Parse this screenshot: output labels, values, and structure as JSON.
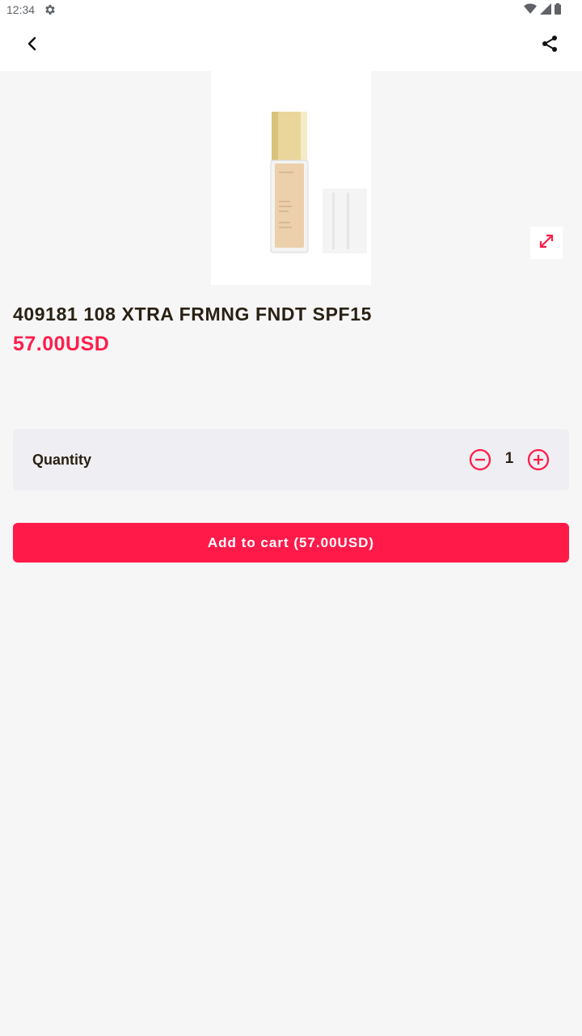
{
  "status_bar": {
    "time": "12:34",
    "icons": [
      "gear-icon",
      "wifi-icon",
      "signal-icon",
      "battery-icon"
    ]
  },
  "app_bar": {
    "back_icon": "chevron-left-icon",
    "share_icon": "share-icon"
  },
  "product": {
    "title": "409181 108 XTRA FRMNG FNDT SPF15",
    "price": "57.00USD",
    "expand_icon": "expand-icon"
  },
  "quantity": {
    "label": "Quantity",
    "value": "1",
    "minus_icon": "minus-circle-icon",
    "plus_icon": "plus-circle-icon"
  },
  "cart": {
    "button_label": "Add to cart (57.00USD)"
  },
  "colors": {
    "accent": "#ff1a4a",
    "text": "#2a2113",
    "background": "#f6f6f7",
    "card": "#efeef2"
  }
}
